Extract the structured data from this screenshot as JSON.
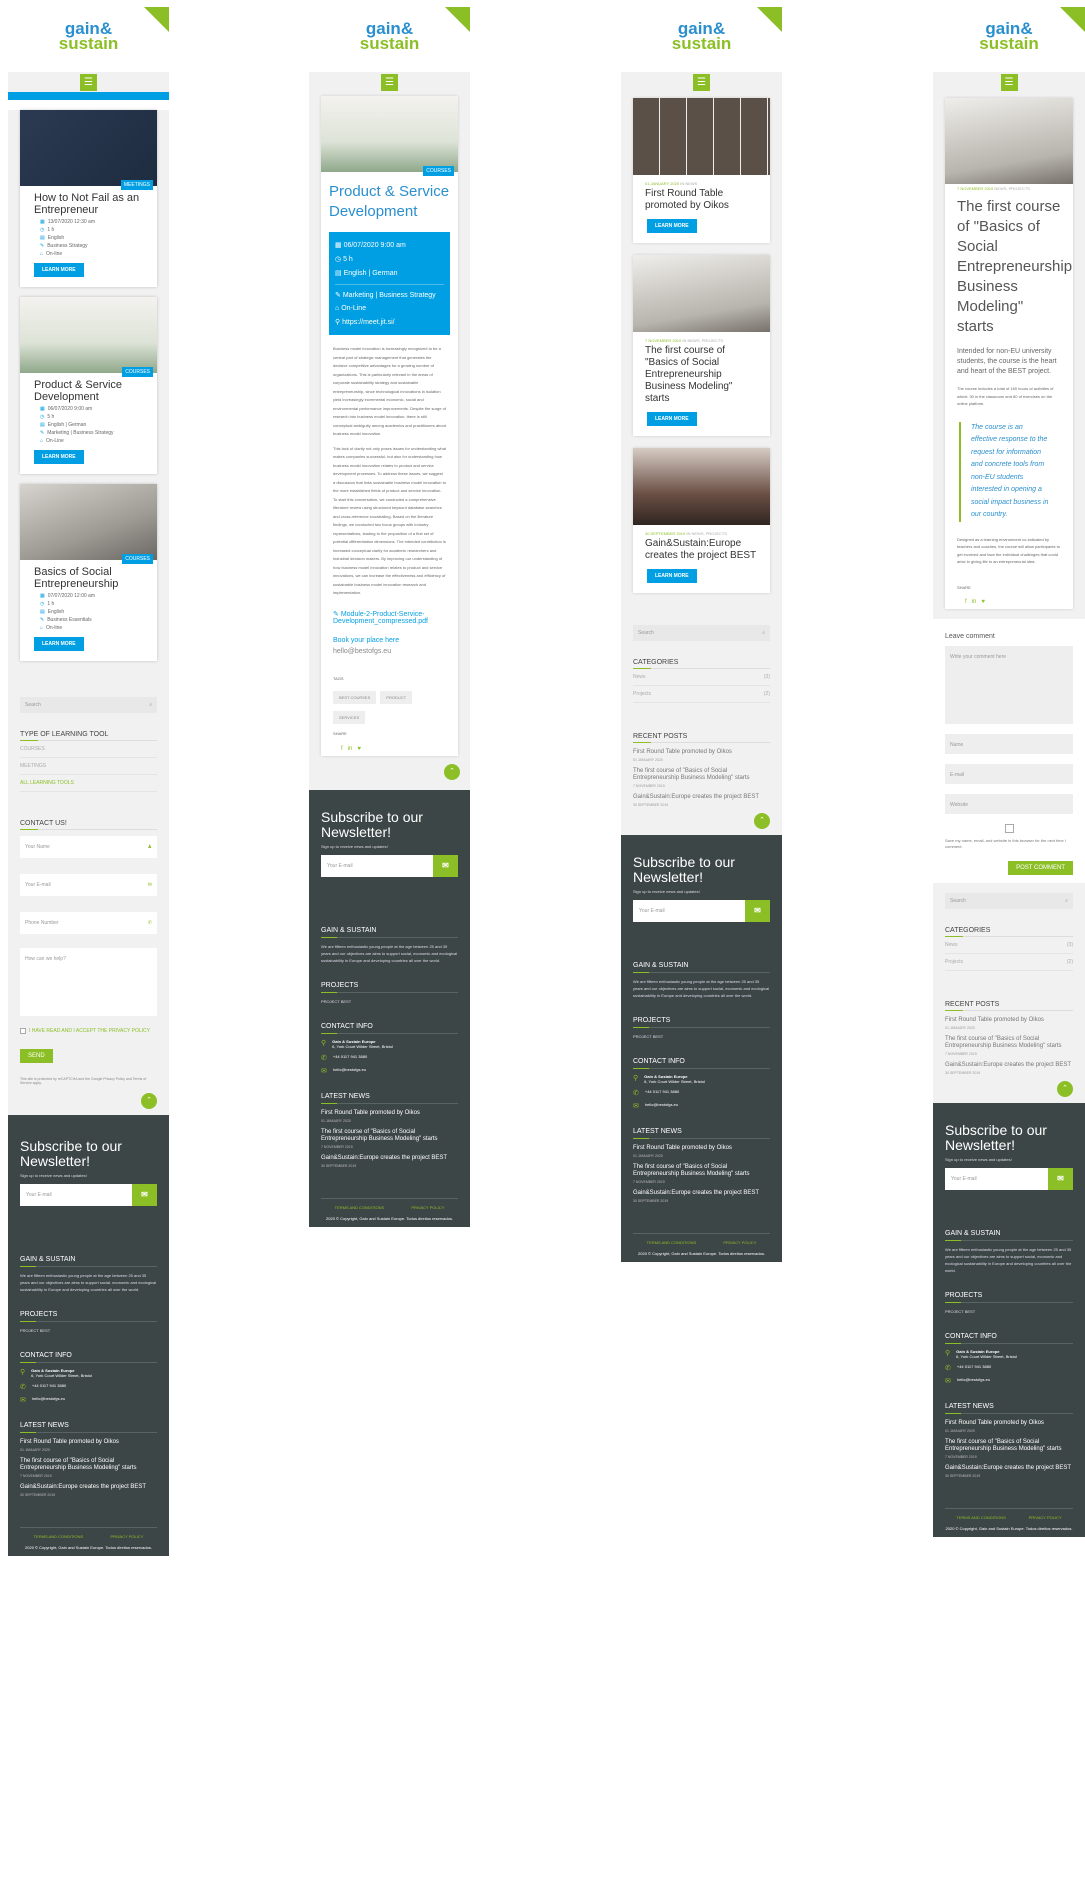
{
  "brand": {
    "logo_top": "gain&",
    "logo_bottom": "sustain",
    "accent": "#8cbf26",
    "blue": "#009fe3",
    "dark": "#3d4646"
  },
  "menu_icon": "☰",
  "p1": {
    "courses": [
      {
        "title": "How to Not Fail as an Entrepreneur",
        "badge": "MEETINGS",
        "date": "13/07/2020 12:30 am",
        "dur": "1 h",
        "lang": "English",
        "cat": "Business Strategy",
        "mode": "On-line",
        "btn": "LEARN MORE"
      },
      {
        "title": "Product & Service Development",
        "badge": "COURSES",
        "date": "06/07/2020 9:00 am",
        "dur": "5 h",
        "lang": "English | German",
        "cat": "Marketing | Business Strategy",
        "mode": "On-Line",
        "btn": "LEARN MORE"
      },
      {
        "title": "Basics of Social Entrepreneurship",
        "badge": "COURSES",
        "date": "07/07/2020 12:00 am",
        "dur": "1 h",
        "lang": "English",
        "cat": "Business Essentials",
        "mode": "On-line",
        "btn": "LEARN MORE"
      }
    ],
    "search": "Search",
    "type_heading": "TYPE OF LEARNING TOOL",
    "types": [
      "COURSES",
      "MEETINGS",
      "ALL LEARNING TOOLS"
    ],
    "contact_heading": "CONTACT US!",
    "fields": [
      "Your Name",
      "Your E-mail",
      "Phone Number",
      "How can we help?"
    ],
    "accept": "I HAVE READ AND I ACCEPT THE PRIVACY POLICY",
    "send": "SEND",
    "recaptcha": "This site is protected by reCAPTCHA and the Google Privacy Policy and Terms of Service apply."
  },
  "p2": {
    "badge": "COURSES",
    "title": "Product & Service Development",
    "info": [
      "06/07/2020 9:00 am",
      "5 h",
      "English | German",
      "Marketing | Business Strategy",
      "On-Line",
      "https://meet.jit.si/"
    ],
    "body1": "Business model innovation is increasingly recognized to be a central part of strategic management that generates the decisive competitive advantages for a growing number of organizations. This is particularly relevant in the areas of corporate sustainability strategy and sustainable entrepreneurship, since technological innovations in isolation yield increasingly incremental economic, social and environmental performance improvements. Despite the surge of research into business model innovation, there is still conceptual ambiguity among academics and practitioners about business model innovation.",
    "body2": "This lack of clarity not only poses issues for understanding what makes companies successful, but also for understanding how business model innovation relates to product and service development processes. To address these issues, we suggest a discussion that links sustainable business model innovation to the more established fields of product and service innovation. To start this conversation, we conducted a comprehensive literature review using structured keyword database searches and cross-reference snowballing. Based on the literature findings, we conducted two focus groups with industry representatives, leading to the proposition of a first set of potential differentiation dimensions. The intended contribution is increased conceptual clarity for academic researchers and industrial decision makers. By improving our understanding of how business model innovation relates to product and service innovations, we can increase the effectiveness and efficiency of sustainable business model innovation research and implementation.",
    "file": "Module-2-Product-Service-Development_compressed.pdf",
    "book": "Book your place here",
    "email": "hello@bestofgs.eu",
    "tags_h": "TAGS",
    "tags": [
      "BEST COURSES",
      "PRODUCT",
      "SERVICES"
    ],
    "share_h": "SHARE"
  },
  "p3": {
    "posts": [
      {
        "date": "01 JANUARY 2020",
        "cat": "IN NEWS",
        "title": "First Round Table promoted by Oikos",
        "btn": "LEARN MORE"
      },
      {
        "date": "7 NOVEMBER 2019",
        "cat": "IN NEWS, PROJECTS",
        "title": "The first course of \"Basics of Social Entrepreneurship Business Modeling\" starts",
        "btn": "LEARN MORE"
      },
      {
        "date": "30 SEPTEMBER 2019",
        "cat": "IN NEWS, PROJECTS",
        "title": "Gain&Sustain:Europe creates the project BEST",
        "btn": "LEARN MORE"
      }
    ],
    "categories_h": "CATEGORIES",
    "categories": [
      {
        "name": "News",
        "count": "(3)"
      },
      {
        "name": "Projects",
        "count": "(2)"
      }
    ],
    "recent_h": "RECENT POSTS",
    "recent": [
      {
        "t": "First Round Table promoted by Oikos",
        "d": "01 JANUARY 2020"
      },
      {
        "t": "The first course of \"Basics of Social Entrepreneurship Business Modeling\" starts",
        "d": "7 NOVEMBER 2019"
      },
      {
        "t": "Gain&Sustain:Europe creates the project BEST",
        "d": "30 SEPTEMBER 2019"
      }
    ]
  },
  "p4": {
    "date": "7 NOVEMBER 2019",
    "cat": "NEWS, PROJECTS",
    "title": "The first course of \"Basics of Social Entrepreneurship Business Modeling\" starts",
    "lead": "Intended for non-EU university students, the course is the heart and heart of the BEST project.",
    "sm1": "The course includes a total of 160 hours of activities of which: 30 in the classroom and 80 of exercises on the online platform.",
    "quote": "The course is an effective response to the request for information and concrete tools from non-EU students interested in opening a social impact business in our country.",
    "sm2": "Designed as a learning environment co-indicated by teachers and coaches, the course will allow participants to get involved and face the individual challenges that could arise in giving life to an entrepreneurial idea.",
    "leave": "Leave comment",
    "comment_ph": "Write your comment here",
    "fields": [
      "Name",
      "E-mail",
      "Website"
    ],
    "save": "Save my name, email, and website in this browser for the next time I comment.",
    "post_btn": "POST COMMENT"
  },
  "footer": {
    "nl_title": "Subscribe to our Newsletter!",
    "nl_sub": "Sign up to receive news and updates!",
    "nl_ph": "Your E-mail",
    "about_h": "GAIN & SUSTAIN",
    "about": "We are fifteen enthusiastic young people at the age between 25 and 35 years and our objectives are aims to support social, economic and ecological sustainability in Europe and developing countries all over the world.",
    "projects_h": "PROJECTS",
    "project": "PROJECT BEST",
    "contact_h": "CONTACT INFO",
    "company": "Gain & Sustain Europe",
    "address": "6, York Court Wilder Street, Bristol",
    "phone": "+44 0117 941 3880",
    "mail": "hello@bestofgs.eu",
    "news_h": "LATEST NEWS",
    "terms": "TERMS AND CONDITIONS",
    "privacy": "PRIVACY POLICY",
    "copy": "2020 © Copyright, Gain and Sustain Europe. Todos direitos reservados."
  }
}
